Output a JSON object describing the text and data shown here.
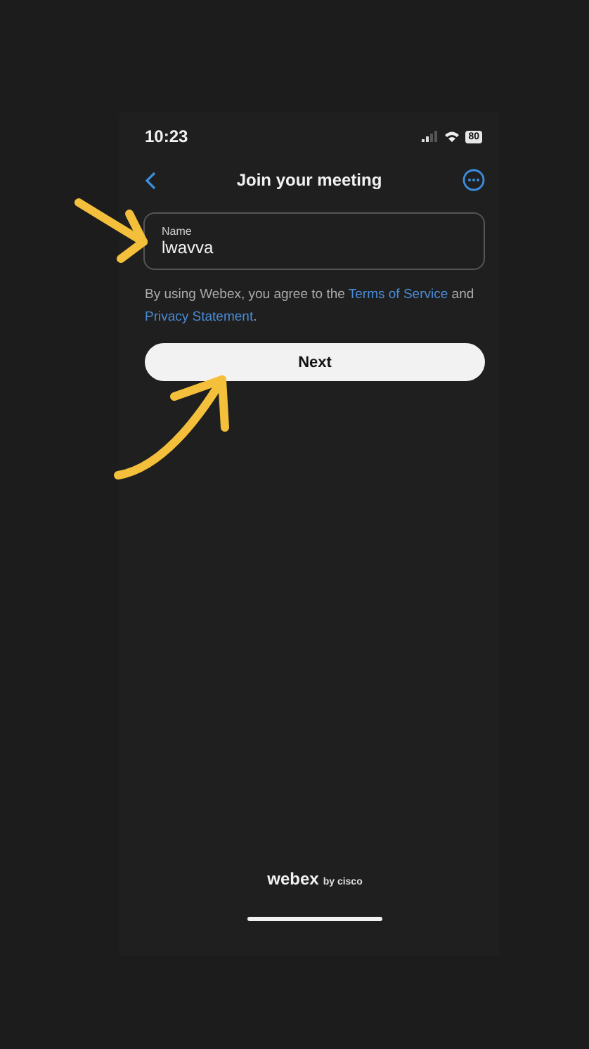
{
  "status_bar": {
    "time": "10:23",
    "battery": "80"
  },
  "nav": {
    "title": "Join your meeting"
  },
  "name_field": {
    "label": "Name",
    "value": "lwavva"
  },
  "consent": {
    "before": "By using Webex, you agree to the ",
    "link_1": "Terms of Service",
    "middle": " and ",
    "link_2": "Privacy Statement",
    "after": "."
  },
  "next_button": {
    "label": "Next"
  },
  "footer": {
    "brand": "webex",
    "suffix": "by cisco"
  }
}
